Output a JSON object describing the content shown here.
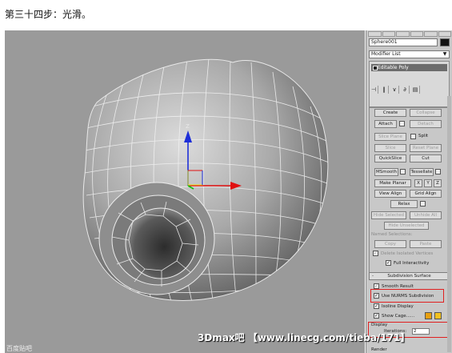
{
  "caption": "第三十四步：光滑。",
  "command_panel": {
    "object_name": "Sphere001",
    "modifier_list": "Modifier List",
    "stack_item": "Editable Poly",
    "buttons": {
      "create": "Create",
      "collapse": "Collapse",
      "attach": "Attach",
      "detach": "Detach",
      "slice_plane": "Slice Plane",
      "split": "Split",
      "slice": "Slice",
      "reset_plane": "Reset Plane",
      "quickslice": "QuickSlice",
      "cut": "Cut",
      "msmooth": "MSmooth",
      "tessellate": "Tessellate",
      "make_planar": "Make Planar",
      "x": "X",
      "y": "Y",
      "z": "Z",
      "view_align": "View Align",
      "grid_align": "Grid Align",
      "relax": "Relax",
      "hide_selected": "Hide Selected",
      "unhide_all": "Unhide All",
      "hide_unselected": "Hide Unselected",
      "copy": "Copy",
      "paste": "Paste"
    },
    "named_selections": "Named Selections:",
    "delete_isolated": "Delete Isolated Vertices",
    "full_interactivity": "Full Interactivity",
    "subdivision_surface": "Subdivision Surface",
    "smooth_result": "Smooth Result",
    "use_nurms": "Use NURMS Subdivision",
    "isoline_display": "Isoline Display",
    "show_cage": "Show Cage......",
    "display": "Display",
    "iterations_label": "Iterations:",
    "iterations_value": "2",
    "render": "Render",
    "cage_colors": [
      "#e8a010",
      "#f0c020"
    ]
  },
  "watermark": "3Dmax吧 【www.linecg.com/tieba/171】",
  "bottom_logo": "百度贴吧"
}
